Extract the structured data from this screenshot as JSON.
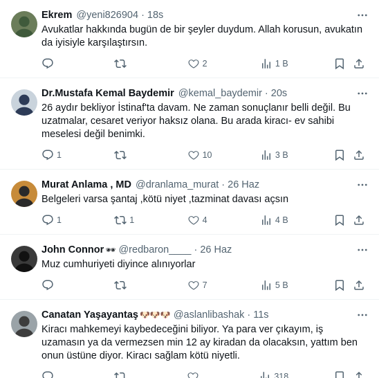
{
  "tweets": [
    {
      "name": "Ekrem",
      "handle": "@yeni826904",
      "dot": "·",
      "time": "18s",
      "emoji": "",
      "text": "Avukatlar hakkında bugün de bir şeyler duydum. Allah korusun, avukatın da iyisiyle karşılaştırsın.",
      "replies": "",
      "retweets": "",
      "likes": "2",
      "views": "1 B",
      "avatar_colors": [
        "#6b7d5a",
        "#3f5a3b"
      ]
    },
    {
      "name": "Dr.Mustafa Kemal Baydemir",
      "handle": "@kemal_baydemir",
      "dot": "·",
      "time": "20s",
      "emoji": "",
      "text": "26 aydır bekliyor İstinaf'ta davam. Ne zaman sonuçlanır belli değil. Bu uzatmalar, cesaret veriyor haksız olana. Bu arada kiracı- ev sahibi meselesi değil benimki.",
      "replies": "1",
      "retweets": "",
      "likes": "10",
      "views": "3 B",
      "avatar_colors": [
        "#c9d3dc",
        "#2d3b57"
      ]
    },
    {
      "name": "Murat Anlama , MD",
      "handle": "@dranlama_murat",
      "dot": "·",
      "time": "26 Haz",
      "emoji": "",
      "text": "Belgeleri varsa şantaj ,kötü niyet  ,tazminat davası açsın",
      "replies": "1",
      "retweets": "1",
      "likes": "4",
      "views": "4 B",
      "avatar_colors": [
        "#c78b3a",
        "#2a2a2a"
      ]
    },
    {
      "name": "John Connor",
      "handle": "@redbaron____",
      "dot": "·",
      "time": "26 Haz",
      "emoji": "🕶",
      "text": "Muz cumhuriyeti diyince alınıyorlar",
      "replies": "",
      "retweets": "",
      "likes": "7",
      "views": "5 B",
      "avatar_colors": [
        "#3a3a3a",
        "#111111"
      ]
    },
    {
      "name": "Canatan Yaşayantaş",
      "handle": "@aslanlibashak",
      "dot": "·",
      "time": "11s",
      "emoji": "🐶🐶🐶",
      "text": "Kiracı mahkemeyi kaybedeceğini biliyor. Ya para ver çıkayım, iş uzamasın ya da vermezsen min 12 ay kiradan da olacaksın, yattım ben onun üstüne diyor. Kiracı sağlam kötü niyetli.",
      "replies": "",
      "retweets": "",
      "likes": "",
      "views": "318",
      "avatar_colors": [
        "#9aa3a8",
        "#3d3d3d"
      ]
    }
  ],
  "colors": {
    "text": "#0f1419",
    "muted": "#536471",
    "divider": "#eff3f4"
  }
}
